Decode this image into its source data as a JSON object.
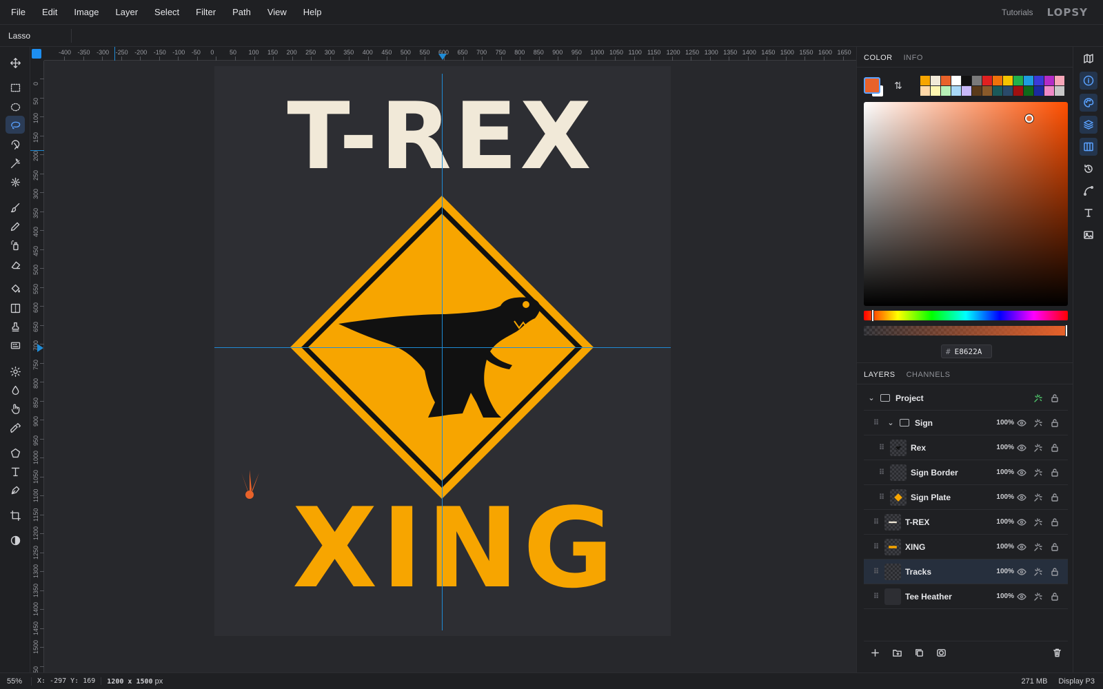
{
  "menu": [
    "File",
    "Edit",
    "Image",
    "Layer",
    "Select",
    "Filter",
    "Path",
    "View",
    "Help"
  ],
  "header": {
    "tutorials": "Tutorials",
    "brand": "LOPSY"
  },
  "options": {
    "tool_name": "Lasso"
  },
  "tools": [
    "move",
    "rect-select",
    "ellipse-select",
    "lasso",
    "object-select",
    "magic-wand",
    "quick-select",
    "brush",
    "pencil",
    "spray",
    "eraser",
    "fill",
    "gradient",
    "clone-stamp",
    "pattern",
    "dodge",
    "blur",
    "smudge",
    "eyedropper",
    "shape",
    "text",
    "pen",
    "crop",
    "adjust"
  ],
  "active_tool": "lasso",
  "ruler": {
    "top_labels": [
      "-400",
      "-350",
      "-300",
      "-250",
      "-200",
      "-150",
      "-100",
      "-50",
      "0",
      "50",
      "100",
      "150",
      "200",
      "250",
      "300",
      "350",
      "400",
      "450",
      "500",
      "550",
      "600",
      "650",
      "700",
      "750",
      "800",
      "850",
      "900",
      "950",
      "1000",
      "1050",
      "1100",
      "1150",
      "1200",
      "1250",
      "1300",
      "1350",
      "1400",
      "1450",
      "1500",
      "1550",
      "1600",
      "1650"
    ],
    "left_labels": [
      "0",
      "50",
      "100",
      "150",
      "200",
      "250",
      "300",
      "350",
      "400",
      "450",
      "500",
      "550",
      "600",
      "650",
      "700",
      "750",
      "800",
      "850",
      "900",
      "950",
      "1000",
      "1050",
      "1100",
      "1150",
      "1200",
      "1250",
      "1300",
      "1350",
      "1400",
      "1450",
      "1500",
      "50"
    ]
  },
  "artwork": {
    "title": "T-REX",
    "subtitle": "XING"
  },
  "color_panel": {
    "tabs": [
      "COLOR",
      "INFO"
    ],
    "active_tab": "COLOR",
    "foreground": "#e8622a",
    "background": "#ffffff",
    "hex_value": "E8622A",
    "palette": [
      "#f7a500",
      "#f1e9d8",
      "#e8622a",
      "#ffffff",
      "#111111",
      "#7a7a7a",
      "#e02020",
      "#f0720a",
      "#f5c400",
      "#22b14c",
      "#1e9de0",
      "#3a3ad8",
      "#b42bc8",
      "#f7a6b9",
      "#ffd8a8",
      "#fff6b0",
      "#b6f0b6",
      "#a8d8f8",
      "#c8b8f8",
      "#5a3a1a",
      "#8a5a2a",
      "#1a5a5a",
      "#2a4a6a",
      "#a01010",
      "#0f6a1a",
      "#1a2aa0",
      "#f08ac8",
      "#c8c8c8"
    ]
  },
  "layers_panel": {
    "tabs": [
      "LAYERS",
      "CHANNELS"
    ],
    "active_tab": "LAYERS",
    "layers": [
      {
        "name": "Project",
        "type": "group-root",
        "opacity": ""
      },
      {
        "name": "Sign",
        "type": "group",
        "opacity": "100%"
      },
      {
        "name": "Rex",
        "type": "layer",
        "opacity": "100%"
      },
      {
        "name": "Sign Border",
        "type": "layer",
        "opacity": "100%"
      },
      {
        "name": "Sign Plate",
        "type": "layer",
        "opacity": "100%"
      },
      {
        "name": "T-REX",
        "type": "layer",
        "opacity": "100%"
      },
      {
        "name": "XING",
        "type": "layer",
        "opacity": "100%"
      },
      {
        "name": "Tracks",
        "type": "layer",
        "opacity": "100%",
        "selected": true
      },
      {
        "name": "Tee Heather",
        "type": "layer",
        "opacity": "100%"
      }
    ]
  },
  "right_sidebar": [
    "map-icon",
    "info-icon",
    "palette-icon",
    "layers-icon",
    "columns-icon",
    "history-icon",
    "path-icon",
    "text-icon",
    "image-icon"
  ],
  "status": {
    "zoom": "55%",
    "coords": "X: -297  Y: 169",
    "dims_value": "1200 x 1500",
    "dims_unit": "px",
    "memory": "271 MB",
    "display": "Display P3"
  }
}
